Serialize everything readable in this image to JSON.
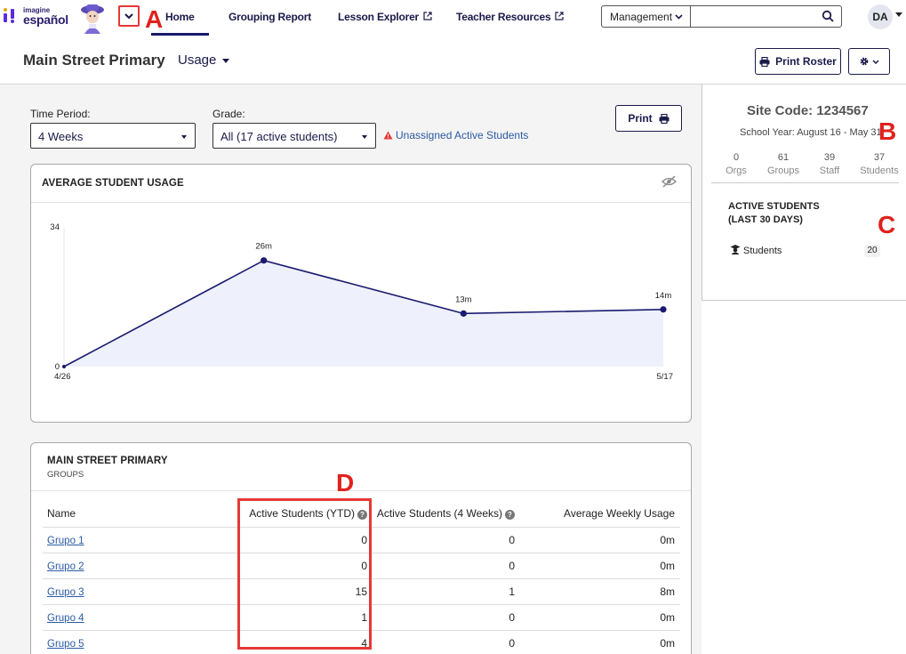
{
  "brand": {
    "top": "imagine",
    "main": "español"
  },
  "markers": {
    "a": "A",
    "b": "B",
    "c": "C",
    "d": "D"
  },
  "nav": {
    "home": "Home",
    "grouping_report": "Grouping Report",
    "lesson_explorer": "Lesson Explorer",
    "teacher_resources": "Teacher Resources",
    "management": "Management",
    "search_placeholder": "",
    "avatar_initials": "DA"
  },
  "header": {
    "title": "Main Street Primary",
    "view": "Usage",
    "print_roster": "Print Roster"
  },
  "filters": {
    "time_period_label": "Time Period:",
    "time_period_value": "4 Weeks",
    "grade_label": "Grade:",
    "grade_value": "All (17 active students)",
    "unassigned_link": "Unassigned Active Students",
    "print": "Print"
  },
  "usage_card": {
    "title": "AVERAGE STUDENT USAGE"
  },
  "chart_data": {
    "type": "area",
    "title": "AVERAGE STUDENT USAGE",
    "x_tick_labels": [
      "4/26",
      "5/17"
    ],
    "y_tick_labels": [
      "0",
      "34"
    ],
    "ylim": [
      0,
      34
    ],
    "points": [
      {
        "x": 0,
        "y": 0,
        "label": ""
      },
      {
        "x": 1,
        "y": 26,
        "label": "26m"
      },
      {
        "x": 2,
        "y": 13,
        "label": "13m"
      },
      {
        "x": 3,
        "y": 14,
        "label": "14m"
      }
    ],
    "line_color": "#1a1a6e",
    "fill_color": "#eef0fb",
    "grid": false
  },
  "groups_card": {
    "title": "MAIN STREET PRIMARY",
    "subtitle": "GROUPS",
    "columns": [
      "Name",
      "Active Students (YTD)",
      "Active Students (4 Weeks)",
      "Average Weekly Usage"
    ],
    "rows": [
      {
        "name": "Grupo 1",
        "ytd": "0",
        "four_weeks": "0",
        "avg": "0m"
      },
      {
        "name": "Grupo 2",
        "ytd": "0",
        "four_weeks": "0",
        "avg": "0m"
      },
      {
        "name": "Grupo 3",
        "ytd": "15",
        "four_weeks": "1",
        "avg": "8m"
      },
      {
        "name": "Grupo 4",
        "ytd": "1",
        "four_weeks": "0",
        "avg": "0m"
      },
      {
        "name": "Grupo 5",
        "ytd": "4",
        "four_weeks": "0",
        "avg": "0m"
      }
    ]
  },
  "site": {
    "code": "Site Code: 1234567",
    "school_year": "School Year: August 16 - May 31",
    "stats": [
      {
        "num": "0",
        "label": "Orgs"
      },
      {
        "num": "61",
        "label": "Groups"
      },
      {
        "num": "39",
        "label": "Staff"
      },
      {
        "num": "37",
        "label": "Students"
      }
    ],
    "active_title_1": "ACTIVE STUDENTS",
    "active_title_2": "(LAST 30 DAYS)",
    "students_label": "Students",
    "students_count": "20"
  },
  "colors": {
    "accent": "#1a1a6e",
    "link": "#2b5ba3",
    "marker": "#e0211c"
  }
}
